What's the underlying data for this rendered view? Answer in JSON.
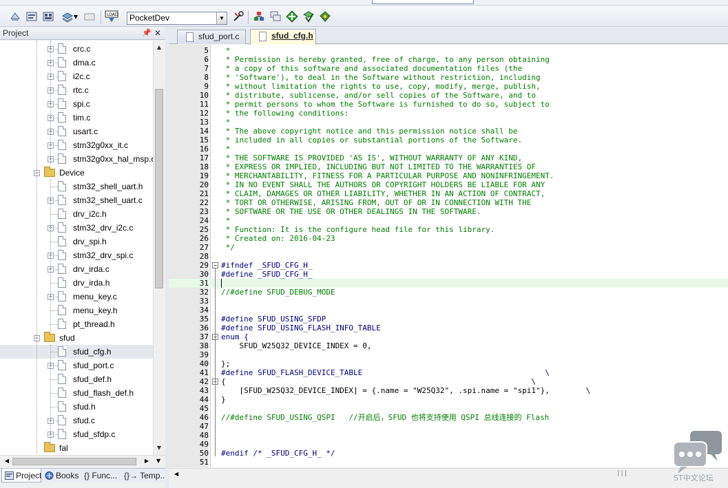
{
  "toolbar": {
    "target_name": "PocketDev"
  },
  "project_panel": {
    "title": "Project",
    "tree": [
      {
        "label": "crc.c",
        "type": "file",
        "expandable": true
      },
      {
        "label": "dma.c",
        "type": "file",
        "expandable": true
      },
      {
        "label": "i2c.c",
        "type": "file",
        "expandable": true
      },
      {
        "label": "rtc.c",
        "type": "file",
        "expandable": true
      },
      {
        "label": "spi.c",
        "type": "file",
        "expandable": true
      },
      {
        "label": "tim.c",
        "type": "file",
        "expandable": true
      },
      {
        "label": "usart.c",
        "type": "file",
        "expandable": true
      },
      {
        "label": "stm32g0xx_it.c",
        "type": "file",
        "expandable": true
      },
      {
        "label": "stm32g0xx_hal_msp.c",
        "type": "file",
        "expandable": true
      },
      {
        "label": "Device",
        "type": "folder",
        "expandable": true
      },
      {
        "label": "stm32_shell_uart.h",
        "type": "file",
        "expandable": false
      },
      {
        "label": "stm32_shell_uart.c",
        "type": "file",
        "expandable": true
      },
      {
        "label": "drv_i2c.h",
        "type": "file",
        "expandable": false
      },
      {
        "label": "stm32_drv_i2c.c",
        "type": "file",
        "expandable": true
      },
      {
        "label": "drv_spi.h",
        "type": "file",
        "expandable": false
      },
      {
        "label": "stm32_drv_spi.c",
        "type": "file",
        "expandable": true
      },
      {
        "label": "drv_irda.c",
        "type": "file",
        "expandable": true
      },
      {
        "label": "drv_irda.h",
        "type": "file",
        "expandable": false
      },
      {
        "label": "menu_key.c",
        "type": "file",
        "expandable": true
      },
      {
        "label": "menu_key.h",
        "type": "file",
        "expandable": false
      },
      {
        "label": "pt_thread.h",
        "type": "file",
        "expandable": false
      },
      {
        "label": "sfud",
        "type": "folder",
        "expandable": true
      },
      {
        "label": "sfud_cfg.h",
        "type": "file",
        "expandable": false,
        "selected": true
      },
      {
        "label": "sfud_port.c",
        "type": "file",
        "expandable": true
      },
      {
        "label": "sfud_def.h",
        "type": "file",
        "expandable": false
      },
      {
        "label": "sfud_flash_def.h",
        "type": "file",
        "expandable": false
      },
      {
        "label": "sfud.h",
        "type": "file",
        "expandable": false
      },
      {
        "label": "sfud.c",
        "type": "file",
        "expandable": true
      },
      {
        "label": "sfud_sfdp.c",
        "type": "file",
        "expandable": true
      },
      {
        "label": "fal",
        "type": "folder",
        "expandable": false
      }
    ],
    "bottom_tabs": [
      {
        "label": "Project",
        "active": true
      },
      {
        "label": "Books",
        "active": false
      },
      {
        "label": "{} Func...",
        "active": false
      },
      {
        "label": "{}→ Temp...",
        "active": false
      }
    ]
  },
  "editor": {
    "tabs": [
      {
        "label": "sfud_port.c",
        "active": false
      },
      {
        "label": "sfud_cfg.h",
        "active": true
      }
    ],
    "current_line": 31,
    "lines": [
      {
        "n": "5",
        "text": " * ",
        "kind": "comment"
      },
      {
        "n": "6",
        "text": " * Permission is hereby granted, free of charge, to any person obtaining",
        "kind": "comment"
      },
      {
        "n": "7",
        "text": " * a copy of this software and associated documentation files (the",
        "kind": "comment"
      },
      {
        "n": "8",
        "text": " * 'Software'), to deal in the Software without restriction, including",
        "kind": "comment"
      },
      {
        "n": "9",
        "text": " * without limitation the rights to use, copy, modify, merge, publish,",
        "kind": "comment"
      },
      {
        "n": "10",
        "text": " * distribute, sublicense, and/or sell copies of the Software, and to",
        "kind": "comment"
      },
      {
        "n": "11",
        "text": " * permit persons to whom the Software is furnished to do so, subject to",
        "kind": "comment"
      },
      {
        "n": "12",
        "text": " * the following conditions:",
        "kind": "comment"
      },
      {
        "n": "13",
        "text": " *",
        "kind": "comment"
      },
      {
        "n": "14",
        "text": " * The above copyright notice and this permission notice shall be",
        "kind": "comment"
      },
      {
        "n": "15",
        "text": " * included in all copies or substantial portions of the Software.",
        "kind": "comment"
      },
      {
        "n": "16",
        "text": " *",
        "kind": "comment"
      },
      {
        "n": "17",
        "text": " * THE SOFTWARE IS PROVIDED 'AS IS', WITHOUT WARRANTY OF ANY KIND,",
        "kind": "comment"
      },
      {
        "n": "18",
        "text": " * EXPRESS OR IMPLIED, INCLUDING BUT NOT LIMITED TO THE WARRANTIES OF",
        "kind": "comment"
      },
      {
        "n": "19",
        "text": " * MERCHANTABILITY, FITNESS FOR A PARTICULAR PURPOSE AND NONINFRINGEMENT.",
        "kind": "comment"
      },
      {
        "n": "20",
        "text": " * IN NO EVENT SHALL THE AUTHORS OR COPYRIGHT HOLDERS BE LIABLE FOR ANY",
        "kind": "comment"
      },
      {
        "n": "21",
        "text": " * CLAIM, DAMAGES OR OTHER LIABILITY, WHETHER IN AN ACTION OF CONTRACT,",
        "kind": "comment"
      },
      {
        "n": "22",
        "text": " * TORT OR OTHERWISE, ARISING FROM, OUT OF OR IN CONNECTION WITH THE",
        "kind": "comment"
      },
      {
        "n": "23",
        "text": " * SOFTWARE OR THE USE OR OTHER DEALINGS IN THE SOFTWARE.",
        "kind": "comment"
      },
      {
        "n": "24",
        "text": " *",
        "kind": "comment"
      },
      {
        "n": "25",
        "text": " * Function: It is the configure head file for this library.",
        "kind": "comment"
      },
      {
        "n": "26",
        "text": " * Created on: 2016-04-23",
        "kind": "comment"
      },
      {
        "n": "27",
        "text": " */",
        "kind": "comment"
      },
      {
        "n": "28",
        "text": "",
        "kind": "plain"
      },
      {
        "n": "29",
        "text": "#ifndef _SFUD_CFG_H_",
        "kind": "pre",
        "fold": "minus"
      },
      {
        "n": "30",
        "text": "#define _SFUD_CFG_H_",
        "kind": "pre"
      },
      {
        "n": "31",
        "text": "",
        "kind": "plain"
      },
      {
        "n": "32",
        "text": "//#define SFUD_DEBUG_MODE",
        "kind": "comment"
      },
      {
        "n": "33",
        "text": "",
        "kind": "plain"
      },
      {
        "n": "34",
        "text": "",
        "kind": "plain"
      },
      {
        "n": "35",
        "text": "#define SFUD_USING_SFDP",
        "kind": "pre"
      },
      {
        "n": "36",
        "text": "#define SFUD_USING_FLASH_INFO_TABLE",
        "kind": "pre"
      },
      {
        "n": "37",
        "text": "enum {",
        "kind": "kw",
        "fold": "minus"
      },
      {
        "n": "38",
        "text": "    SFUD_W25Q32_DEVICE_INDEX = 0,",
        "kind": "num"
      },
      {
        "n": "39",
        "text": "",
        "kind": "plain"
      },
      {
        "n": "40",
        "text": "};",
        "kind": "plain"
      },
      {
        "n": "41",
        "text": "#define SFUD_FLASH_DEVICE_TABLE                                        \\",
        "kind": "pre"
      },
      {
        "n": "42",
        "text": "{                                                                   \\",
        "kind": "plain",
        "fold": "minus"
      },
      {
        "n": "43",
        "text": "    [SFUD_W25Q32_DEVICE_INDEX] = {.name = \"W25Q32\", .spi.name = \"spi1\"},        \\",
        "kind": "str"
      },
      {
        "n": "44",
        "text": "}",
        "kind": "plain"
      },
      {
        "n": "45",
        "text": "",
        "kind": "plain"
      },
      {
        "n": "46",
        "text": "//#define SFUD_USING_QSPI   //开启后，SFUD 也将支持使用 QSPI 总线连接的 Flash",
        "kind": "comment"
      },
      {
        "n": "47",
        "text": "",
        "kind": "plain"
      },
      {
        "n": "48",
        "text": "",
        "kind": "plain"
      },
      {
        "n": "49",
        "text": "",
        "kind": "plain"
      },
      {
        "n": "50",
        "text": "#endif /* _SFUD_CFG_H_ */",
        "kind": "pre"
      },
      {
        "n": "51",
        "text": "",
        "kind": "plain"
      }
    ]
  },
  "watermark": {
    "text": "ST中文论坛"
  }
}
